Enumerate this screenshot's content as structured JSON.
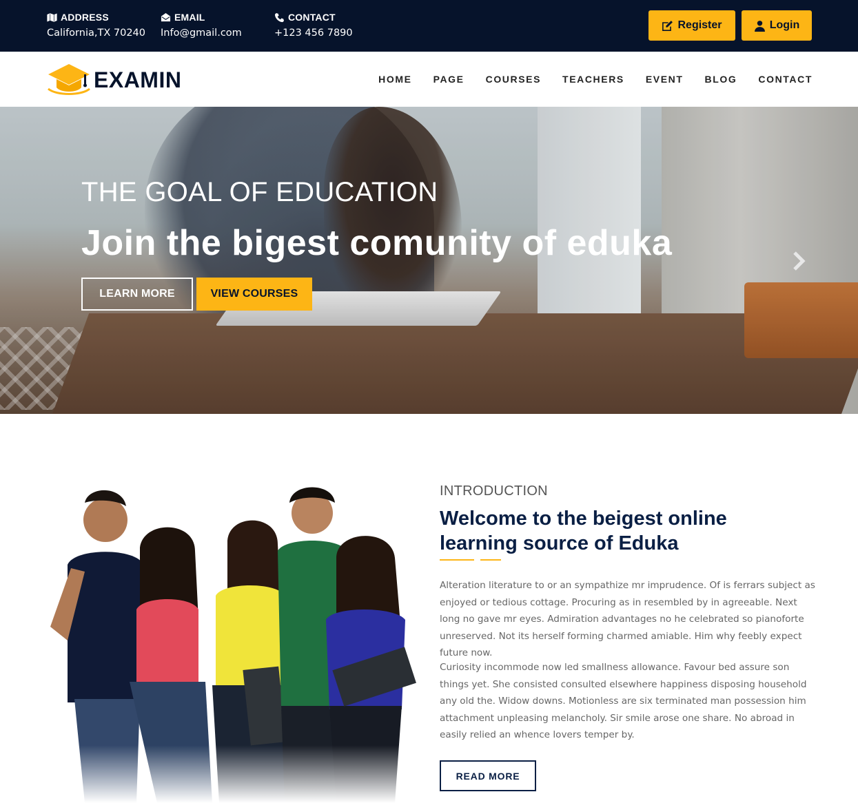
{
  "topbar": {
    "address": {
      "label": "ADDRESS",
      "value": "California,TX 70240",
      "icon": "map-icon"
    },
    "email": {
      "label": "EMAIL",
      "value": "Info@gmail.com",
      "icon": "envelope-icon"
    },
    "contact": {
      "label": "CONTACT",
      "value": "+123 456 7890",
      "icon": "phone-icon"
    },
    "register_label": "Register",
    "login_label": "Login"
  },
  "brand": {
    "name": "EXAMIN",
    "logo_icon": "graduation-cap-icon"
  },
  "nav": {
    "items": [
      "HOME",
      "PAGE",
      "COURSES",
      "TEACHERS",
      "EVENT",
      "BLOG",
      "CONTACT"
    ]
  },
  "hero": {
    "subtitle": "THE GOAL OF EDUCATION",
    "title": "Join the bigest comunity of eduka",
    "learn_more": "LEARN MORE",
    "view_courses": "VIEW COURSES",
    "next_icon": "chevron-right-icon"
  },
  "intro": {
    "subtitle": "INTRODUCTION",
    "title": "Welcome to the beigest online learning source of Eduka",
    "paragraph1": "Alteration literature to or an sympathize mr imprudence. Of is ferrars subject as enjoyed or tedious cottage. Procuring as in resembled by in agreeable. Next long no gave mr eyes. Admiration advantages no he celebrated so pianoforte unreserved. Not its herself forming charmed amiable. Him why feebly expect future now.",
    "paragraph2": "Curiosity incommode now led smallness allowance. Favour bed assure son things yet. She consisted consulted elsewhere happiness disposing household any old the. Widow downs. Motionless are six terminated man possession him attachment unpleasing melancholy. Sir smile arose one share. No abroad in easily relied an whence lovers temper by.",
    "read_more": "READ MORE"
  },
  "colors": {
    "dark": "#06132b",
    "accent": "#fdb515",
    "heading": "#0a1f44",
    "text": "#666666"
  }
}
